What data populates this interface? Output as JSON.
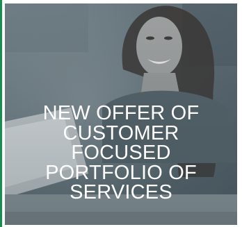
{
  "promo": {
    "headline_lines": [
      "NEW OFFER OF",
      "CUSTOMER",
      "FOCUSED",
      "PORTFOLIO OF",
      "SERVICES"
    ]
  },
  "colors": {
    "accent_bar": "#1e8a52",
    "overlay": "#4f5f68",
    "text": "#ffffff"
  },
  "icons": {
    "photo": "person-at-laptop-photo"
  }
}
